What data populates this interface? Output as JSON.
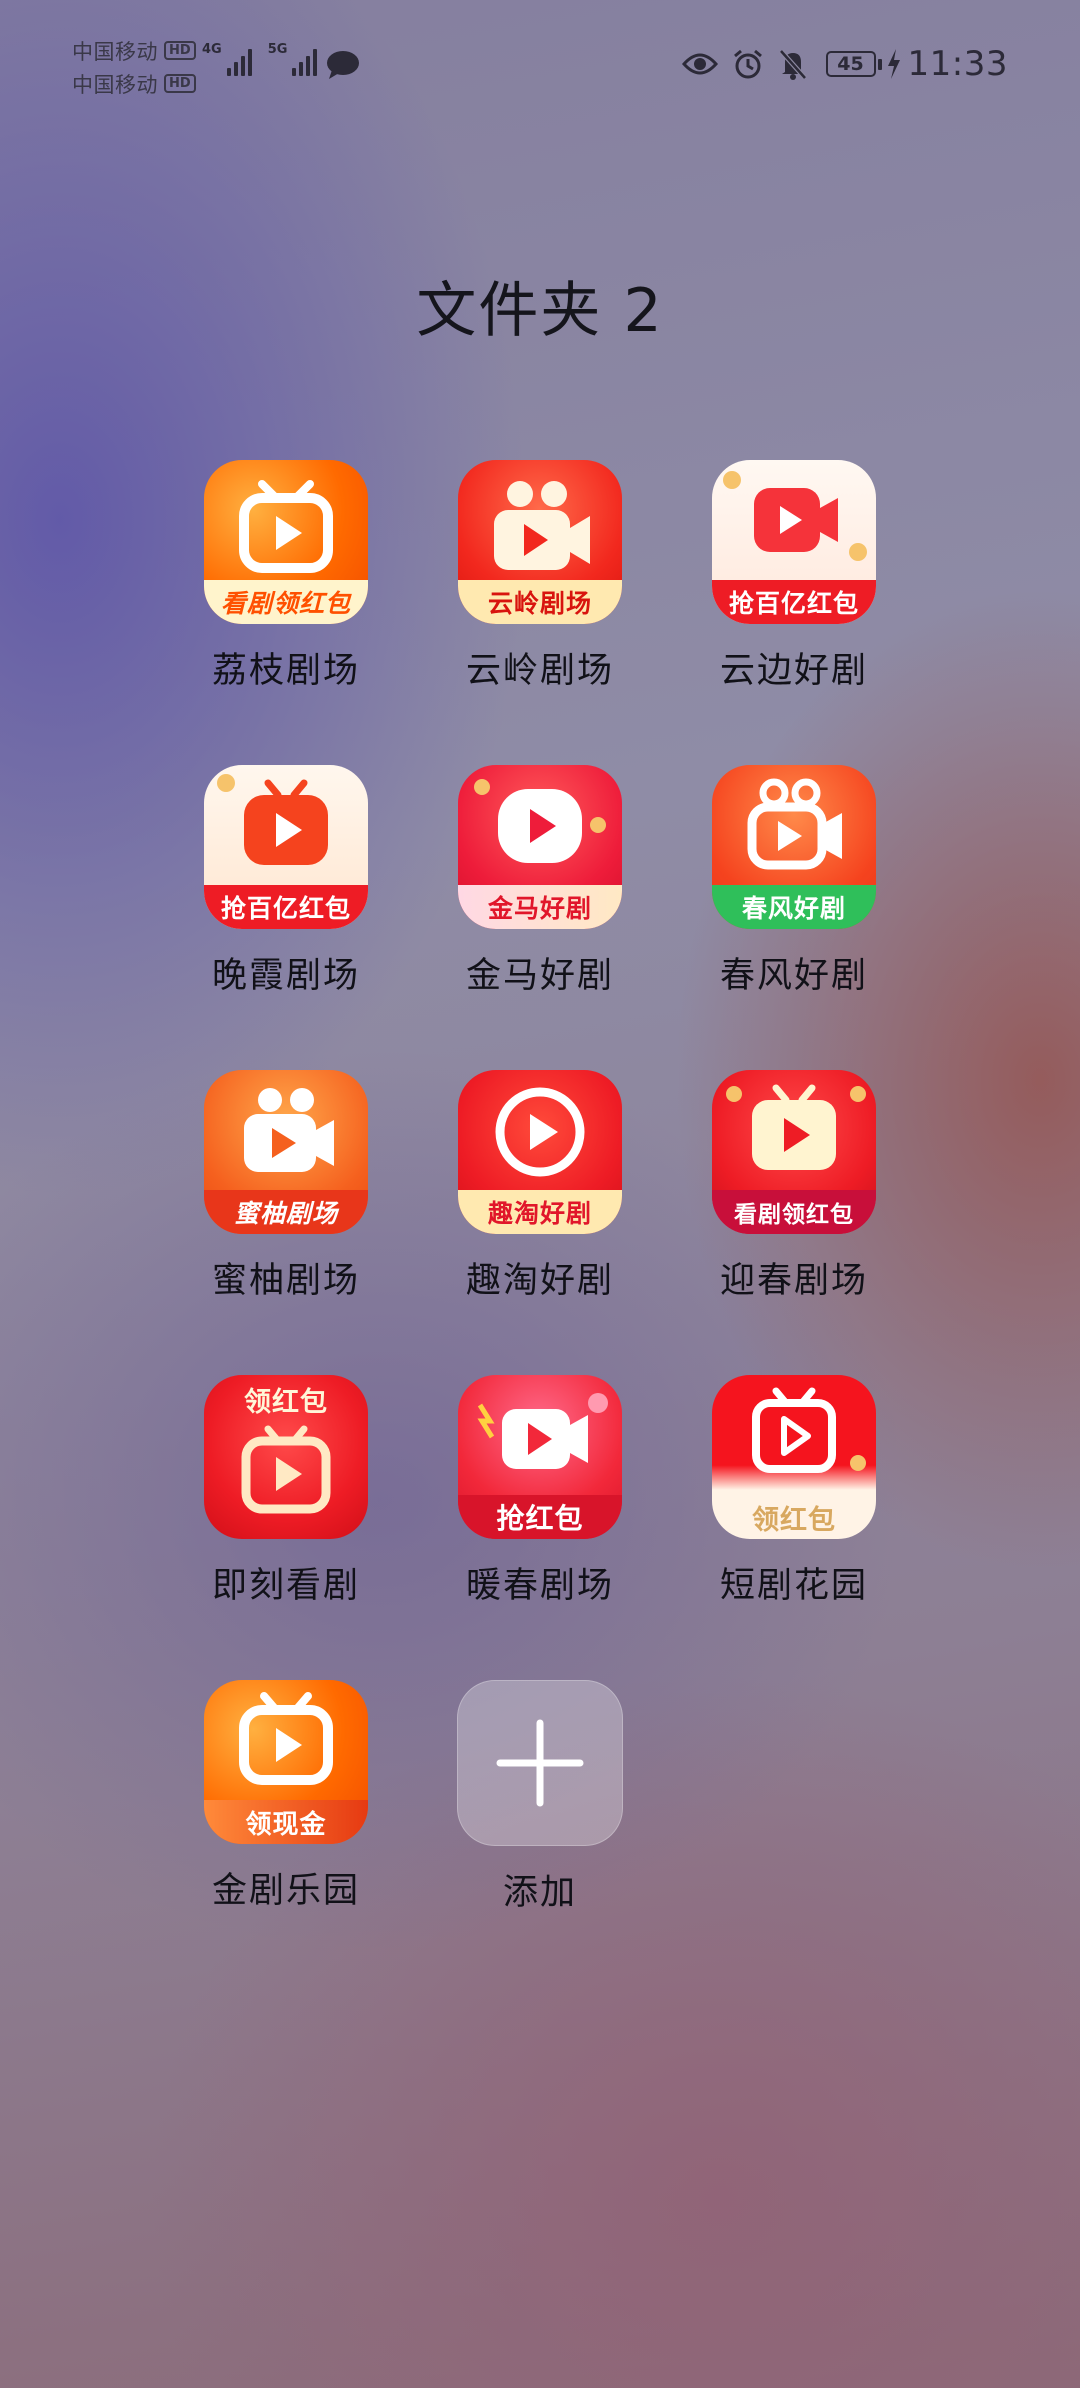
{
  "status_bar": {
    "carrier_1": "中国移动",
    "carrier_2": "中国移动",
    "hd_label": "HD",
    "net_1": "4G",
    "net_2": "5G",
    "icons": [
      "eye-icon",
      "alarm-icon",
      "mute-bell-icon",
      "charging-bolt-icon"
    ],
    "battery_level": "45",
    "time": "11:33"
  },
  "folder": {
    "title": "文件夹 2"
  },
  "apps": [
    {
      "label": "荔枝剧场",
      "banner": "看剧领红包",
      "icon": "tv-play-icon"
    },
    {
      "label": "云岭剧场",
      "banner": "云岭剧场",
      "icon": "camera-play-icon"
    },
    {
      "label": "云边好剧",
      "banner": "抢百亿红包",
      "icon": "video-play-icon"
    },
    {
      "label": "晚霞剧场",
      "banner": "抢百亿红包",
      "icon": "tv-play-icon"
    },
    {
      "label": "金马好剧",
      "banner": "金马好剧",
      "icon": "play-bubble-icon"
    },
    {
      "label": "春风好剧",
      "banner": "春风好剧",
      "icon": "camera-play-icon"
    },
    {
      "label": "蜜柚剧场",
      "banner": "蜜柚剧场",
      "icon": "camera-play-icon"
    },
    {
      "label": "趣淘好剧",
      "banner": "趣淘好剧",
      "icon": "play-circle-icon"
    },
    {
      "label": "迎春剧场",
      "banner": "看剧领红包",
      "icon": "tv-play-icon"
    },
    {
      "label": "即刻看剧",
      "banner": "领红包",
      "icon": "tv-play-icon"
    },
    {
      "label": "暖春剧场",
      "banner": "抢红包",
      "icon": "camera-play-icon"
    },
    {
      "label": "短剧花园",
      "banner": "领红包",
      "icon": "tv-play-icon"
    },
    {
      "label": "金剧乐园",
      "banner": "领现金",
      "icon": "tv-play-icon"
    }
  ],
  "add_tile": {
    "label": "添加",
    "icon": "plus-icon"
  }
}
